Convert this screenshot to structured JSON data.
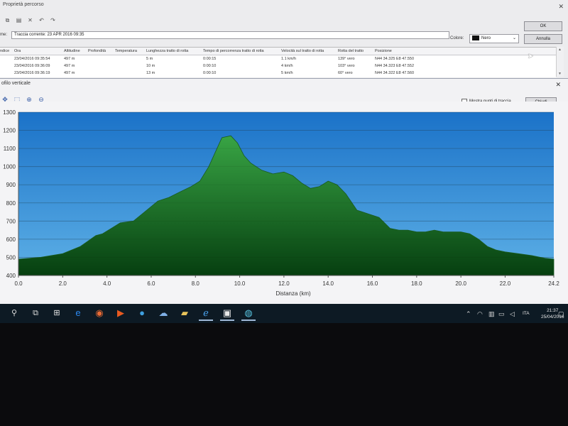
{
  "window_bg": {
    "title": "Proprietà percorso",
    "name_label": "me:",
    "track_name": "Traccia corrente: 23 APR 2016 09:35",
    "color_label": "Colore:",
    "color_value": "Nero",
    "ok_label": "OK",
    "annulla_label": "Annulla",
    "columns": [
      "ndice",
      "Ora",
      "Altitudine",
      "Profondità",
      "Temperatura",
      "Lunghezza tratto di rotta",
      "Tempo di percorrenza tratto di rotta",
      "Velocità sul tratto di rotta",
      "Rotta del tratto",
      "Posizione"
    ],
    "rows": [
      [
        "",
        "23/04/2016 09:35:54",
        "497 m",
        "",
        "",
        "5 m",
        "0:00:15",
        "1.1 km/h",
        "139° vero",
        "N44 34.325 E8 47.550"
      ],
      [
        "",
        "23/04/2016 09:36:09",
        "497 m",
        "",
        "",
        "10 m",
        "0:00:10",
        "4 km/h",
        "103° vero",
        "N44 34.323 E8 47.552"
      ],
      [
        "",
        "23/04/2016 09:36:19",
        "497 m",
        "",
        "",
        "13 m",
        "0:00:10",
        "5 km/h",
        "60° vero",
        "N44 34.322 E8 47.560"
      ]
    ]
  },
  "profile_window": {
    "title": "ofilo verticale",
    "show_points_label": "Mostra punti di traccia",
    "close_label": "Chiudi",
    "x_axis_label": "Distanza (km)"
  },
  "chart_data": {
    "type": "area",
    "xlabel": "Distanza (km)",
    "ylabel": "",
    "xlim": [
      0,
      24.2
    ],
    "ylim": [
      400,
      1300
    ],
    "x_ticks": [
      "0.0",
      "2.0",
      "4.0",
      "6.0",
      "8.0",
      "10.0",
      "12.0",
      "14.0",
      "16.0",
      "18.0",
      "20.0",
      "22.0",
      "24.2"
    ],
    "y_ticks": [
      "400",
      "500",
      "600",
      "700",
      "800",
      "900",
      "1000",
      "1100",
      "1200",
      "1300"
    ],
    "grid": true,
    "series": [
      {
        "x": [
          0,
          1,
          2,
          2.8,
          3.5,
          3.8,
          4.2,
          4.6,
          5.2,
          5.8,
          6.3,
          6.8,
          7.3,
          7.8,
          8.2,
          8.6,
          8.9,
          9.2,
          9.6,
          9.9,
          10.2,
          10.5,
          11,
          11.5,
          12,
          12.4,
          12.8,
          13.2,
          13.6,
          14,
          14.4,
          14.8,
          15.3,
          15.8,
          16.3,
          16.8,
          17.2,
          17.6,
          18,
          18.4,
          18.8,
          19.2,
          19.6,
          20,
          20.4,
          20.8,
          21.2,
          21.6,
          22,
          22.6,
          23.2,
          23.8,
          24.2
        ],
        "y": [
          490,
          500,
          520,
          560,
          620,
          630,
          660,
          690,
          700,
          760,
          810,
          830,
          860,
          890,
          920,
          1000,
          1080,
          1160,
          1170,
          1130,
          1060,
          1020,
          980,
          960,
          970,
          950,
          910,
          880,
          890,
          920,
          900,
          850,
          760,
          740,
          720,
          660,
          650,
          650,
          640,
          640,
          650,
          640,
          640,
          640,
          630,
          600,
          560,
          540,
          530,
          520,
          510,
          495,
          490
        ]
      }
    ],
    "colors": {
      "area_top": "#38a444",
      "area_bottom": "#063f10",
      "sky_top": "#1b72c8",
      "sky_bottom": "#5db0e6"
    }
  },
  "taskbar": {
    "lang": "ITA",
    "time": "21:37",
    "date": "25/04/2016",
    "icons": [
      "search-icon",
      "task-view-icon",
      "windows-store-icon",
      "edge-icon",
      "media-player-icon",
      "video-app-icon",
      "earth-icon",
      "network-drive-icon",
      "folder-icon",
      "ie-icon",
      "photos-icon",
      "chrome-like-icon"
    ]
  }
}
